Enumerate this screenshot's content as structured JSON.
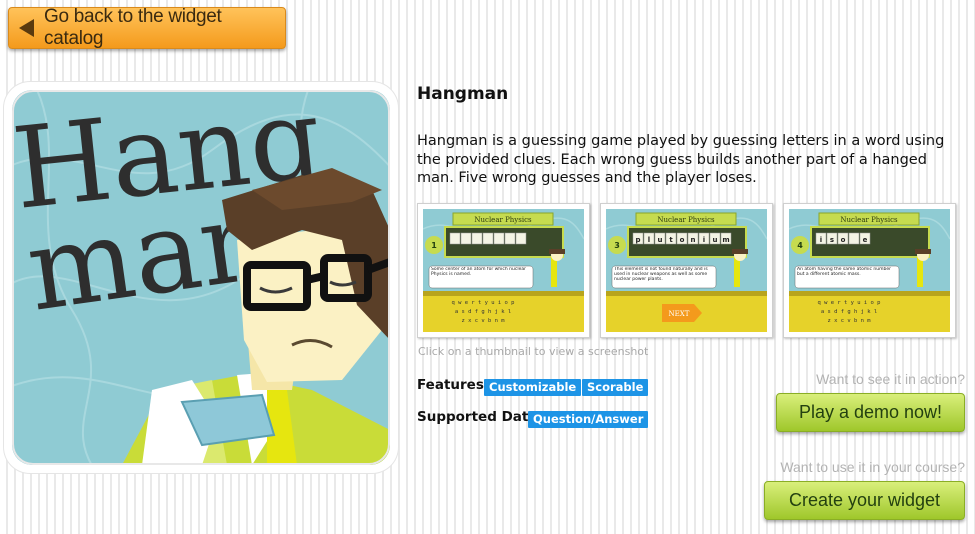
{
  "back_button": {
    "label": "Go back to the widget catalog"
  },
  "hero": {
    "title_line1": "Hang",
    "title_line2": "man"
  },
  "widget": {
    "title": "Hangman",
    "description": "Hangman is a guessing game played by guessing letters in a word using the provided clues. Each wrong guess builds another part of a hanged man. Five wrong guesses and the player loses."
  },
  "thumbnails": {
    "caption": "Click on a thumbnail to view a screenshot",
    "items": [
      {
        "header": "Nuclear Physics",
        "num": "1",
        "word": "",
        "clue": "Some center of an atom for which nuclear Physics is named."
      },
      {
        "header": "Nuclear Physics",
        "num": "3",
        "word": "plutonium",
        "clue": "This element is not found naturally and is used in nuclear weapons as well as some nuclear power plants.",
        "next": "NEXT"
      },
      {
        "header": "Nuclear Physics",
        "num": "4",
        "word": "iso e",
        "clue": "An atom having the same atomic number but a different atomic mass."
      }
    ]
  },
  "features": {
    "label": "Features:",
    "tags": [
      "Customizable",
      "Scorable"
    ]
  },
  "supported_data": {
    "label": "Supported Data:",
    "tags": [
      "Question/Answer"
    ]
  },
  "demo": {
    "prompt": "Want to see it in action?",
    "button": "Play a demo now!"
  },
  "create": {
    "prompt": "Want to use it in your course?",
    "button": "Create your widget"
  },
  "colors": {
    "orange": "#f49a1c",
    "green": "#a5cc30",
    "chip_blue": "#1d94e6",
    "hero_bg": "#8fcbd3"
  }
}
